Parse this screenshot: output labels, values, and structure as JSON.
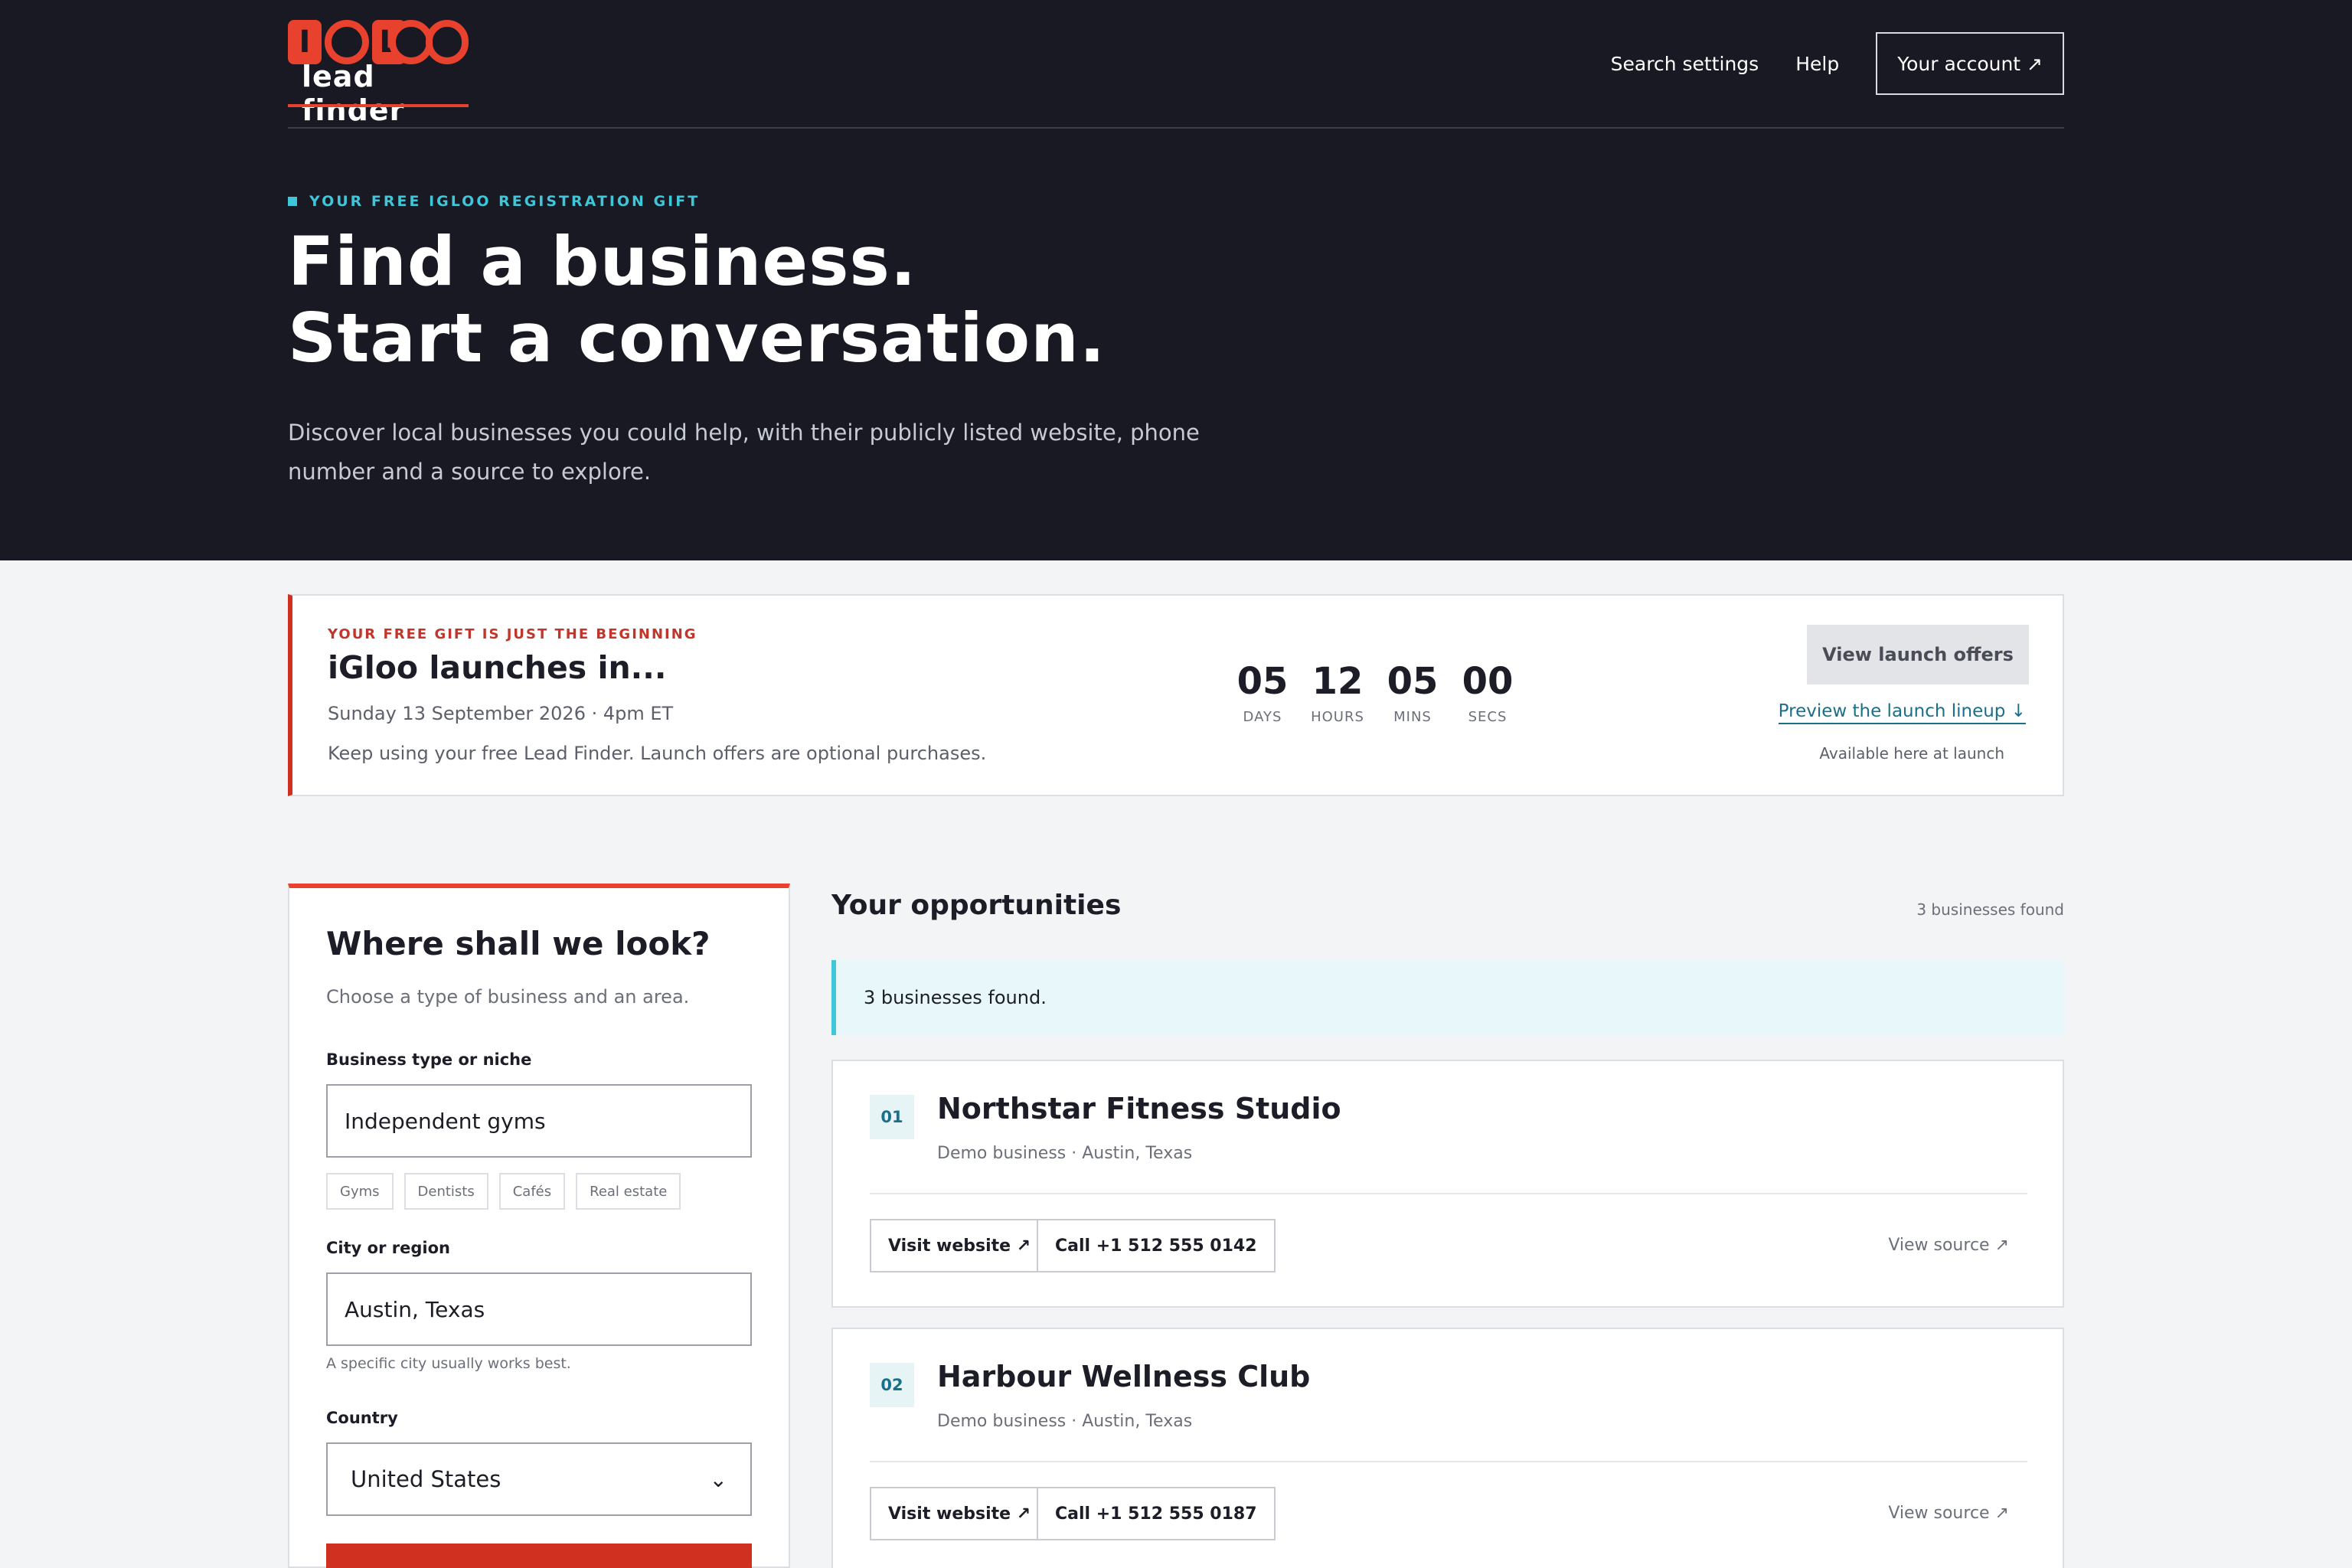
{
  "header": {
    "logo_letters": [
      "I",
      "G",
      "L",
      "O",
      "O"
    ],
    "logo_text": "lead finder",
    "nav": {
      "search_settings": "Search settings",
      "help": "Help",
      "account": "Your account ↗"
    }
  },
  "hero": {
    "eyebrow": "YOUR FREE IGLOO REGISTRATION GIFT",
    "title_line1": "Find a business.",
    "title_line2": "Start a conversation.",
    "subtitle": "Discover local businesses you could help, with their publicly listed website, phone number and a source to explore."
  },
  "launch": {
    "eyebrow": "YOUR FREE GIFT IS JUST THE BEGINNING",
    "title": "iGloo launches in...",
    "date": "Sunday 13 September 2026 · 4pm ET",
    "note": "Keep using your free Lead Finder. Launch offers are optional purchases.",
    "countdown": [
      {
        "value": "05",
        "label": "DAYS"
      },
      {
        "value": "12",
        "label": "HOURS"
      },
      {
        "value": "05",
        "label": "MINS"
      },
      {
        "value": "00",
        "label": "SECS"
      }
    ],
    "offers_button": "View launch offers",
    "preview_link": "Preview the launch lineup ↓",
    "available": "Available here at launch"
  },
  "search": {
    "title": "Where shall we look?",
    "subtitle": "Choose a type of business and an area.",
    "business_label": "Business type or niche",
    "business_value": "Independent gyms",
    "chips": [
      "Gyms",
      "Dentists",
      "Cafés",
      "Real estate"
    ],
    "city_label": "City or region",
    "city_value": "Austin, Texas",
    "city_hint": "A specific city usually works best.",
    "country_label": "Country",
    "country_value": "United States",
    "chevron_icon": "chevron-down-icon"
  },
  "results": {
    "title": "Your opportunities",
    "count": "3 businesses found",
    "notice": "3 businesses found.",
    "items": [
      {
        "rank": "01",
        "name": "Northstar Fitness Studio",
        "meta": "Demo business · Austin, Texas",
        "website": "Visit website ↗",
        "call": "Call +1 512 555 0142",
        "source": "View source ↗"
      },
      {
        "rank": "02",
        "name": "Harbour Wellness Club",
        "meta": "Demo business · Austin, Texas",
        "website": "Visit website ↗",
        "call": "Call +1 512 555 0187",
        "source": "View source ↗"
      }
    ]
  },
  "colors": {
    "brand_red": "#e8412e",
    "accent_cyan": "#3fc6d9",
    "hero_bg": "#181922",
    "link_teal": "#1a6f8a"
  }
}
